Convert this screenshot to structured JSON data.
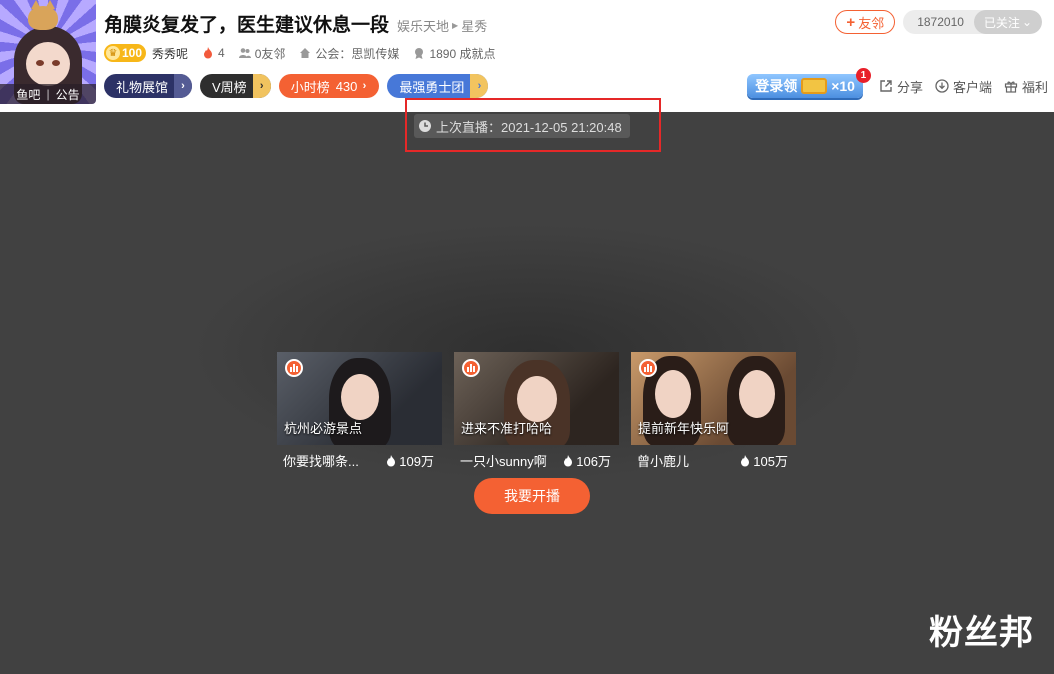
{
  "header": {
    "title": "角膜炎复发了，医生建议休息一段",
    "breadcrumb": [
      "娱乐天地",
      "星秀"
    ],
    "avatar_tabs": [
      "鱼吧",
      "公告"
    ],
    "level": "100",
    "anchor_name": "秀秀呢",
    "hot_count": "4",
    "friends": "0友邻",
    "guild": "公会：思凯传媒",
    "achievement": "1890 成就点",
    "follow_label": "友邻",
    "fans_count": "1872010",
    "followed_label": "已关注",
    "tags": {
      "gift": "礼物展馆",
      "week": "V周榜",
      "hour": "小时榜",
      "hour_count": "430",
      "brave": "最强勇士团"
    },
    "login_reward": "登录领",
    "reward_multiplier": "×10",
    "reward_badge": "1",
    "tools": [
      "分享",
      "客户端",
      "福利"
    ]
  },
  "player": {
    "last_live_label": "上次直播：2021-12-05 21:20:48",
    "recommendations": [
      {
        "caption": "杭州必游景点",
        "name": "你要找哪条...",
        "heat": "109万"
      },
      {
        "caption": "进来不准打哈哈",
        "name": "一只小sunny啊",
        "heat": "106万"
      },
      {
        "caption": "提前新年快乐阿",
        "name": "曾小鹿儿",
        "heat": "105万"
      }
    ],
    "start_button": "我要开播"
  },
  "watermark": "粉丝邦",
  "colors": {
    "accent": "#f46133",
    "highlight": "#e52828",
    "player_bg": "#414141"
  }
}
